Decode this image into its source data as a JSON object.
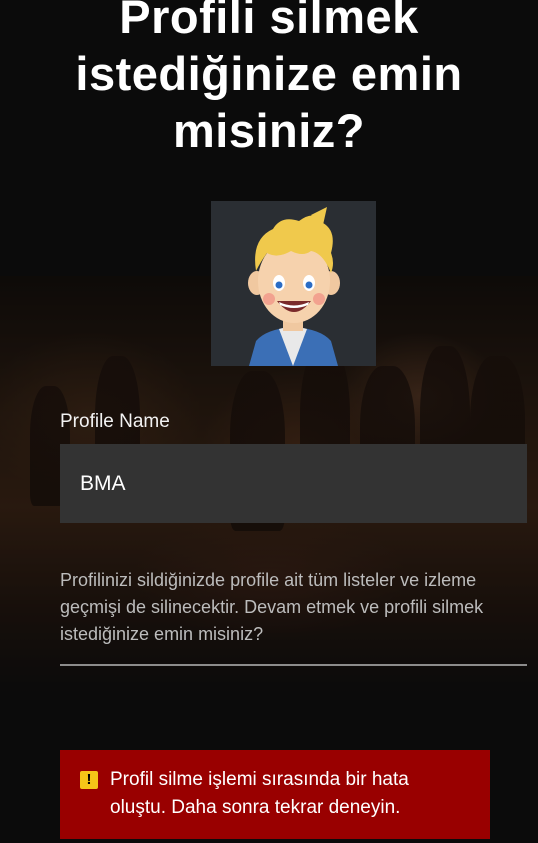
{
  "dialog": {
    "title": "Profili silmek istediğinize emin misiniz?",
    "avatar": {
      "icon": "kid-avatar-icon",
      "bg_color": "#2a2e33"
    },
    "profile_name_label": "Profile Name",
    "profile_name_value": "BMA",
    "description": "Profilinizi sildiğinizde profile ait tüm listeler ve izleme geçmişi de silinecektir. Devam etmek ve profili silmek istediğinize emin misiniz?",
    "error": {
      "icon": "warning-icon",
      "icon_glyph": "!",
      "message": "Profil silme işlemi sırasında bir hata oluştu. Daha sonra tekrar deneyin.",
      "color": "#990000"
    }
  },
  "colors": {
    "background": "#141414",
    "input_bg": "#333333",
    "warning": "#f5c518"
  }
}
